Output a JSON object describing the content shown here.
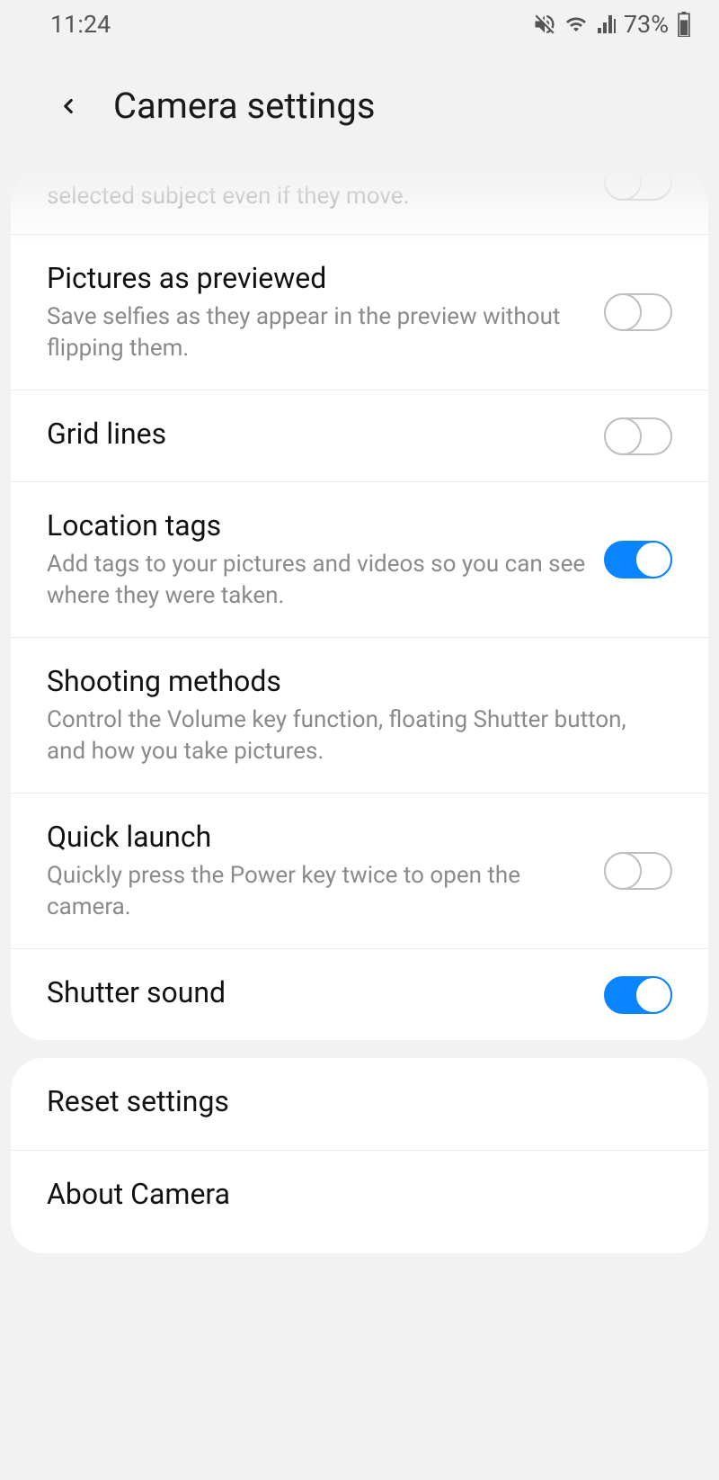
{
  "status_bar": {
    "time": "11:24",
    "battery_pct": "73%"
  },
  "header": {
    "title": "Camera settings"
  },
  "settings": {
    "tracking_af": {
      "desc_visible": "selected subject even if they move.",
      "on": false
    },
    "pictures_as_previewed": {
      "title": "Pictures as previewed",
      "desc": "Save selfies as they appear in the preview without flipping them.",
      "on": false
    },
    "grid_lines": {
      "title": "Grid lines",
      "on": false
    },
    "location_tags": {
      "title": "Location tags",
      "desc": "Add tags to your pictures and videos so you can see where they were taken.",
      "on": true
    },
    "shooting_methods": {
      "title": "Shooting methods",
      "desc": "Control the Volume key function, floating Shutter button, and how you take pictures."
    },
    "quick_launch": {
      "title": "Quick launch",
      "desc": "Quickly press the Power key twice to open the camera.",
      "on": false
    },
    "shutter_sound": {
      "title": "Shutter sound",
      "on": true
    }
  },
  "footer": {
    "reset": {
      "title": "Reset settings"
    },
    "about": {
      "title": "About Camera"
    }
  }
}
